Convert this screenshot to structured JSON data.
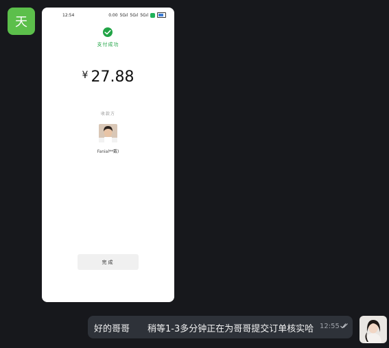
{
  "sender_avatar": {
    "char": "天",
    "color": "#5cbf4b"
  },
  "phone": {
    "status_bar": {
      "time": "12:54",
      "net_speed": "0.00",
      "signal_1": "5Gıl",
      "signal_2": "5Gıl",
      "signal_3": "5Gıl"
    },
    "pay_icon": "wechat-pay-check-icon",
    "pay_success": "支付成功",
    "currency": "¥",
    "amount": "27.88",
    "payee_label": "收款方",
    "payee_name": "Fanial**戴)",
    "done_button": "完成",
    "accent_color": "#21a446"
  },
  "message": {
    "text": "好的哥哥　　稍等1-3多分钟正在为哥哥提交订单核实哈",
    "time": "12:55",
    "read_icon": "double-check-icon"
  }
}
